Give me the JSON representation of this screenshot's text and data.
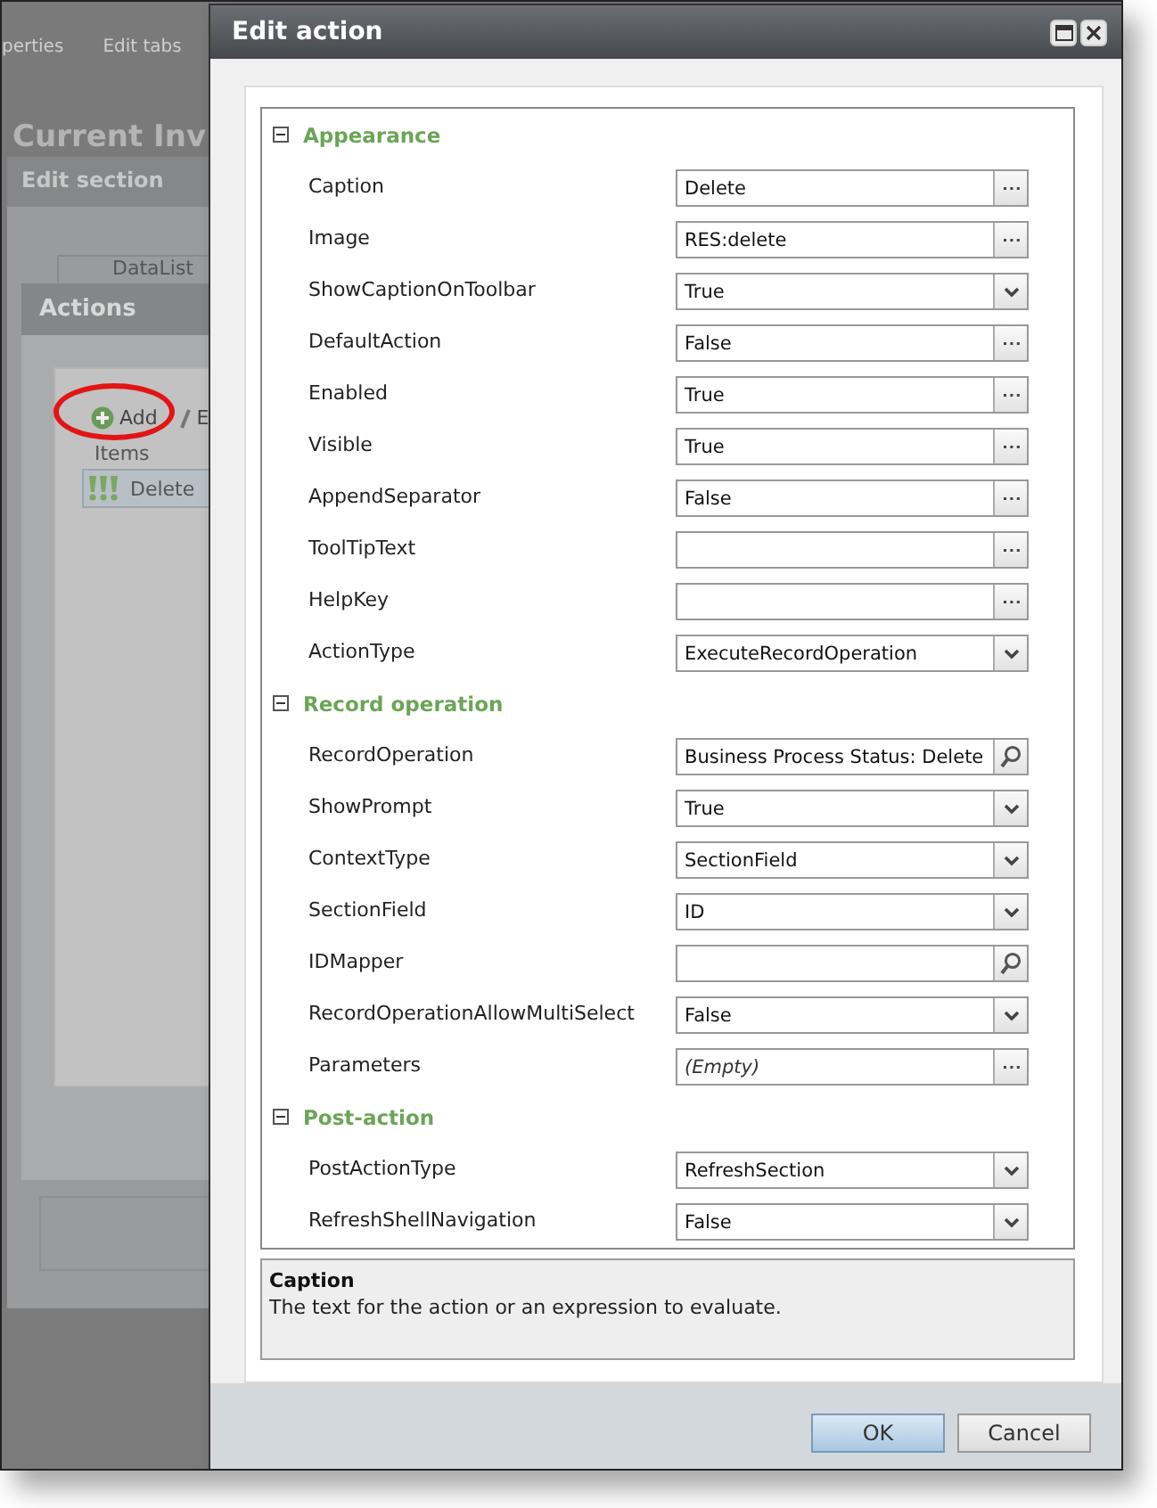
{
  "background": {
    "tabs": [
      "perties",
      "Edit tabs"
    ],
    "page_title": "Current Inv",
    "edit_section": {
      "title": "Edit section",
      "tab": "DataList"
    },
    "actions": {
      "title": "Actions",
      "toolbar": [
        {
          "label": "Add",
          "kind": "add"
        },
        {
          "label": "E",
          "kind": "edit"
        }
      ],
      "column": "Items",
      "items": [
        {
          "label": "Delete",
          "selected": true
        }
      ]
    }
  },
  "dialog": {
    "title": "Edit action",
    "categories": [
      {
        "title": "Appearance",
        "expanded": true,
        "properties": [
          {
            "name": "Caption",
            "value": "Delete",
            "kind": "ellipsis"
          },
          {
            "name": "Image",
            "value": "RES:delete",
            "kind": "ellipsis"
          },
          {
            "name": "ShowCaptionOnToolbar",
            "value": "True",
            "kind": "dropdown"
          },
          {
            "name": "DefaultAction",
            "value": "False",
            "kind": "ellipsis"
          },
          {
            "name": "Enabled",
            "value": "True",
            "kind": "ellipsis"
          },
          {
            "name": "Visible",
            "value": "True",
            "kind": "ellipsis"
          },
          {
            "name": "AppendSeparator",
            "value": "False",
            "kind": "ellipsis"
          },
          {
            "name": "ToolTipText",
            "kind": "ellipsis"
          },
          {
            "name": "HelpKey",
            "kind": "ellipsis"
          },
          {
            "name": "ActionType",
            "value": "ExecuteRecordOperation",
            "kind": "dropdown"
          }
        ]
      },
      {
        "title": "Record operation",
        "expanded": true,
        "properties": [
          {
            "name": "RecordOperation",
            "value": "Business Process Status: Delete",
            "kind": "lookup"
          },
          {
            "name": "ShowPrompt",
            "value": "True",
            "kind": "dropdown"
          },
          {
            "name": "ContextType",
            "value": "SectionField",
            "kind": "dropdown"
          },
          {
            "name": "SectionField",
            "value": "ID",
            "kind": "dropdown"
          },
          {
            "name": "IDMapper",
            "kind": "lookup"
          },
          {
            "name": "RecordOperationAllowMultiSelect",
            "value": "False",
            "kind": "dropdown"
          },
          {
            "name": "Parameters",
            "placeholder": "(Empty)",
            "kind": "ellipsis"
          }
        ]
      },
      {
        "title": "Post-action",
        "expanded": true,
        "properties": [
          {
            "name": "PostActionType",
            "value": "RefreshSection",
            "kind": "dropdown"
          },
          {
            "name": "RefreshShellNavigation",
            "value": "False",
            "kind": "dropdown"
          }
        ]
      }
    ],
    "description": {
      "title": "Caption",
      "text": "The text for the action or an expression to evaluate."
    },
    "buttons": [
      {
        "label": "OK",
        "kind": "default"
      },
      {
        "label": "Cancel",
        "kind": "normal"
      }
    ]
  }
}
